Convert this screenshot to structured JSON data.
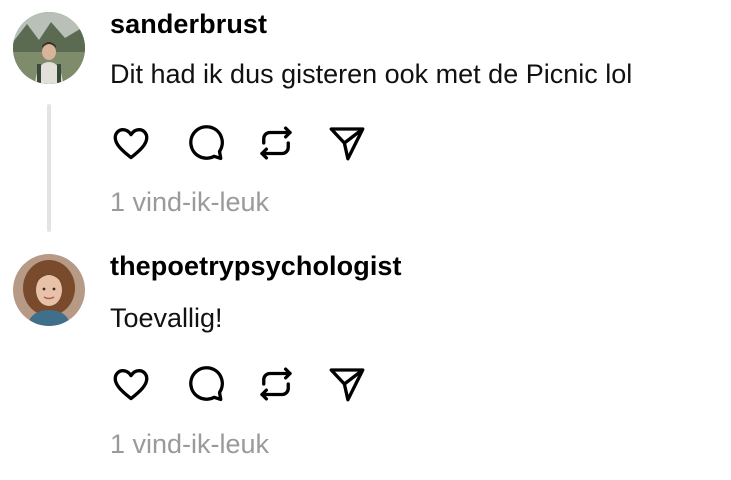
{
  "posts": [
    {
      "username": "sanderbrust",
      "text": "Dit had ik dus gisteren ook met de Picnic lol",
      "likes_label": "1 vind-ik-leuk"
    },
    {
      "username": "thepoetrypsychologist",
      "text": "Toevallig!",
      "likes_label": "1 vind-ik-leuk"
    }
  ],
  "icons": {
    "like": "heart-icon",
    "reply": "comment-icon",
    "repost": "repost-icon",
    "share": "send-icon"
  },
  "colors": {
    "text": "#000000",
    "muted": "#9a9a9a",
    "thread_line": "#e3e3e3",
    "background": "#ffffff"
  }
}
